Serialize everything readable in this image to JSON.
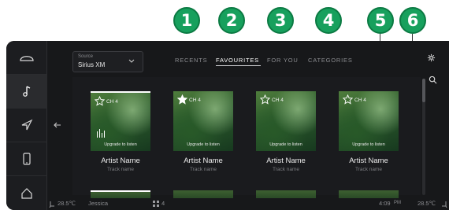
{
  "callouts": [
    "1",
    "2",
    "3",
    "4",
    "5",
    "6"
  ],
  "colors": {
    "callout": "#17a05d",
    "screen_bg": "#17181a",
    "active_text": "#ffffff",
    "inactive_text": "#8a8b8f"
  },
  "rail": [
    {
      "icon": "vehicle-icon"
    },
    {
      "icon": "music-note-icon",
      "active": true
    },
    {
      "icon": "navigation-icon"
    },
    {
      "icon": "phone-icon"
    },
    {
      "icon": "home-icon"
    }
  ],
  "source": {
    "caption": "Source",
    "value": "Sirius XM"
  },
  "tabs": [
    {
      "label": "RECENTS"
    },
    {
      "label": "FAVOURITES",
      "active": true
    },
    {
      "label": "FOR YOU"
    },
    {
      "label": "CATEGORIES"
    }
  ],
  "cards": [
    {
      "channel": "CH 4",
      "favourite": false,
      "playing": true,
      "upgrade": "Upgrade to listen",
      "artist": "Artist Name",
      "track": "Track name"
    },
    {
      "channel": "CH 4",
      "favourite": true,
      "playing": false,
      "upgrade": "Upgrade to listen",
      "artist": "Artist Name",
      "track": "Track name"
    },
    {
      "channel": "CH 4",
      "favourite": false,
      "playing": false,
      "upgrade": "Upgrade to listen",
      "artist": "Artist Name",
      "track": "Track name"
    },
    {
      "channel": "CH 4",
      "favourite": false,
      "playing": false,
      "upgrade": "Upgrade to listen",
      "artist": "Artist Name",
      "track": "Track name"
    }
  ],
  "status": {
    "left_temp": "28.5℃",
    "user": "Jessica",
    "fan_level": "4",
    "time": "4:09",
    "ampm": "PM",
    "right_temp": "28.5℃"
  }
}
